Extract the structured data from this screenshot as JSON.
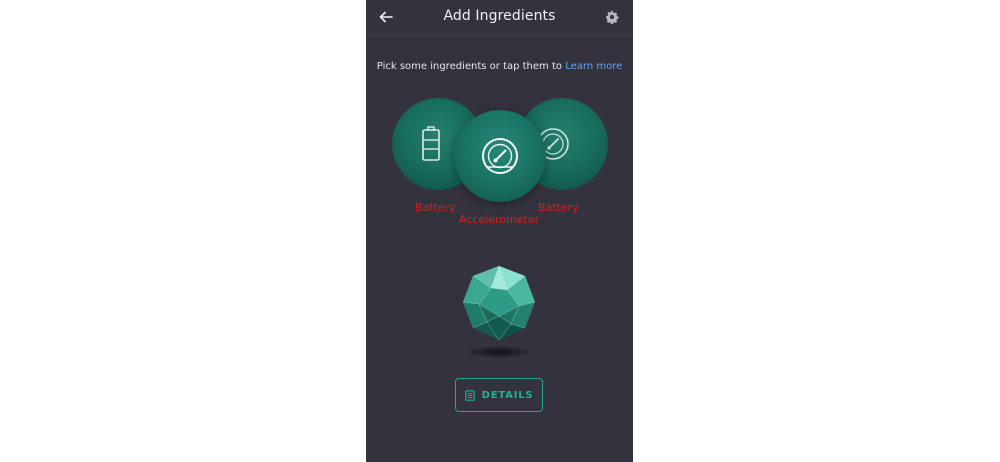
{
  "header": {
    "title": "Add Ingredients",
    "back_icon": "arrow-left-icon",
    "settings_icon": "gear-icon"
  },
  "hint": {
    "text": "Pick some ingredients or tap them to ",
    "link": "Learn more"
  },
  "ingredients": [
    {
      "label": "Battery",
      "icon": "battery-icon"
    },
    {
      "label": "Accelerometer",
      "icon": "gauge-icon"
    },
    {
      "label": "Battery",
      "icon": "gauge-icon"
    }
  ],
  "details_button": {
    "label": "DETAILS",
    "icon": "document-icon"
  },
  "colors": {
    "background": "#34333d",
    "accent": "#22b099",
    "bubble": "#196e5e",
    "label": "#dd1b1b",
    "link": "#61a5f2"
  }
}
